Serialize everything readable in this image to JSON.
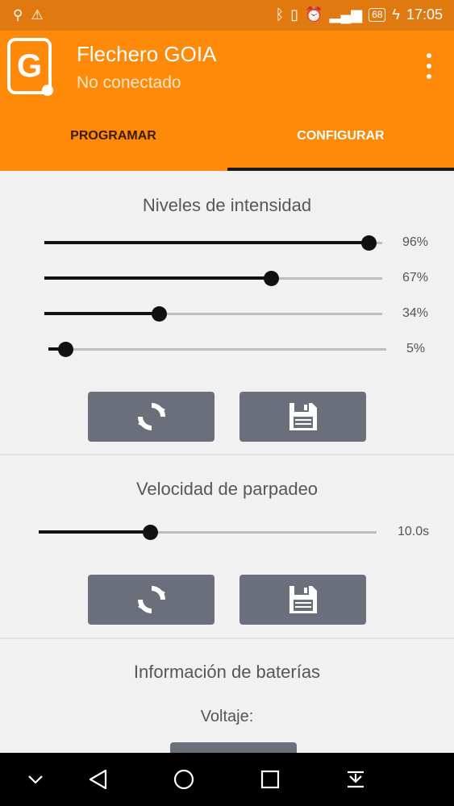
{
  "status_bar": {
    "time": "17:05",
    "battery": "68"
  },
  "app": {
    "title": "Flechero GOIA",
    "subtitle": "No conectado",
    "logo_letter": "G"
  },
  "tabs": [
    {
      "label": "PROGRAMAR"
    },
    {
      "label": "CONFIGURAR",
      "selected": true
    }
  ],
  "intensity": {
    "title": "Niveles de intensidad",
    "sliders": [
      {
        "value": 96,
        "label": "96%"
      },
      {
        "value": 67,
        "label": "67%"
      },
      {
        "value": 34,
        "label": "34%"
      },
      {
        "value": 5,
        "label": "5%"
      }
    ],
    "buttons": [
      {
        "icon": "refresh-icon"
      },
      {
        "icon": "save-icon"
      }
    ]
  },
  "blink": {
    "title": "Velocidad de parpadeo",
    "slider": {
      "value": 33,
      "label": "10.0s"
    },
    "buttons": [
      {
        "icon": "refresh-icon"
      },
      {
        "icon": "save-icon"
      }
    ]
  },
  "battery_info": {
    "title": "Información de baterías",
    "voltage_label": "Voltaje:"
  },
  "nav": [
    "chevron-down-icon",
    "back-icon",
    "home-icon",
    "recents-icon",
    "notifications-pull-icon"
  ],
  "colors": {
    "app_bar": "#ff8a0a",
    "status_bar": "#e07a10",
    "button": "#6b6e7b",
    "slider_active": "#111111"
  }
}
